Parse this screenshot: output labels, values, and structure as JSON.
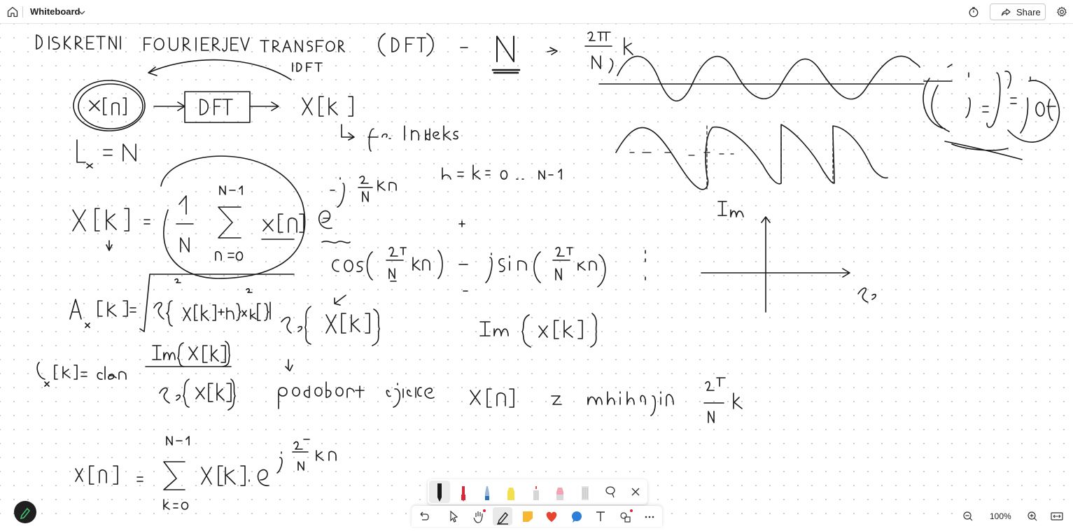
{
  "header": {
    "title": "Whiteboard",
    "share_label": "Share"
  },
  "zoom": {
    "level": "100%"
  },
  "pen_palette": {
    "pens": [
      {
        "name": "black-pen",
        "color": "#1a1a1a"
      },
      {
        "name": "red-pen",
        "color": "#d62839"
      },
      {
        "name": "blue-pen",
        "color": "#2d6fb7"
      },
      {
        "name": "yellow-highlighter",
        "color": "#f4e04d"
      },
      {
        "name": "red-marker",
        "color": "#e5484d"
      },
      {
        "name": "pink-highlighter",
        "color": "#f3a3b3"
      },
      {
        "name": "eraser",
        "color": "#b8b8b8"
      }
    ],
    "lasso_icon": "lasso-icon",
    "close_icon": "close-icon"
  },
  "toolbar": {
    "icons": [
      "undo-icon",
      "select-icon",
      "hand-icon",
      "pen-icon",
      "sticky-note-icon",
      "reaction-heart-icon",
      "chat-bubble-icon",
      "text-icon",
      "shapes-icon",
      "more-icon"
    ]
  },
  "colors": {
    "accent_red_dot": "#d62839",
    "ink": "#1a1a1a",
    "fab_icon": "#3fbf6b"
  }
}
